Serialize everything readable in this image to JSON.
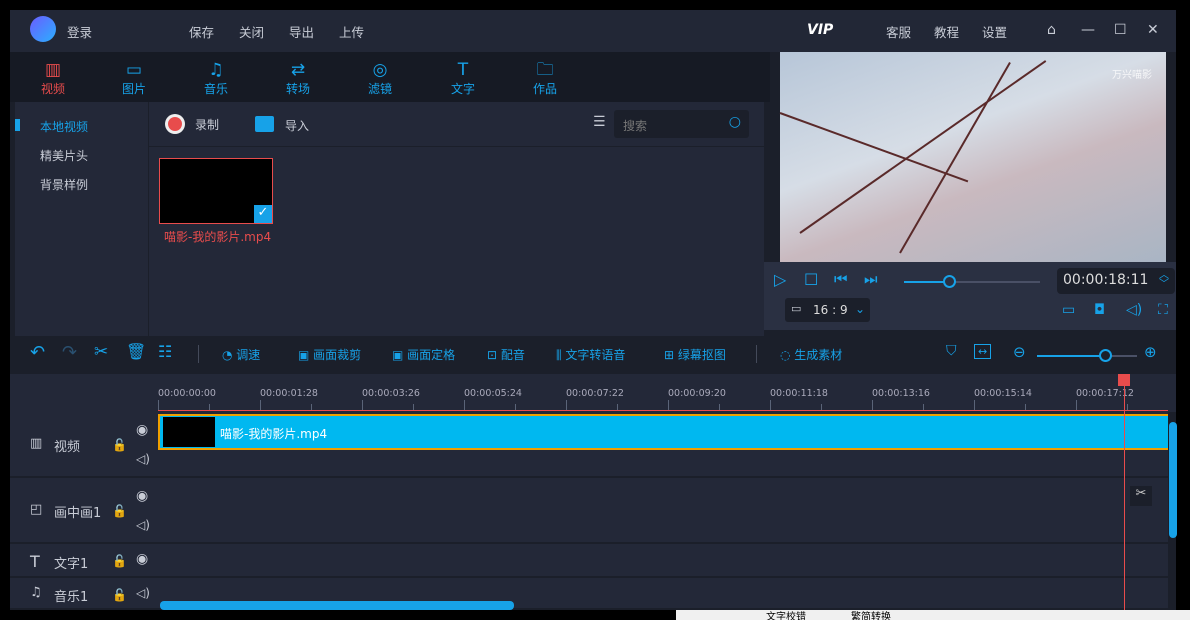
{
  "title_bar": {
    "login": "登录",
    "menu": [
      "保存",
      "关闭",
      "导出",
      "上传"
    ],
    "vip": "VIP",
    "right_menu": [
      "客服",
      "教程",
      "设置"
    ]
  },
  "categories": [
    {
      "label": "视频",
      "icon": "film-icon",
      "active": true
    },
    {
      "label": "图片",
      "icon": "image-icon"
    },
    {
      "label": "音乐",
      "icon": "music-icon"
    },
    {
      "label": "转场",
      "icon": "transition-icon"
    },
    {
      "label": "滤镜",
      "icon": "filter-icon"
    },
    {
      "label": "文字",
      "icon": "text-icon"
    },
    {
      "label": "作品",
      "icon": "folder-icon"
    }
  ],
  "sidebar": {
    "items": [
      "本地视频",
      "精美片头",
      "背景样例"
    ]
  },
  "media": {
    "record": "录制",
    "import": "导入",
    "search_placeholder": "搜索",
    "items": [
      {
        "name": "喵影-我的影片.mp4"
      }
    ]
  },
  "player": {
    "time": "00:00:18:11",
    "aspect": "16 : 9",
    "progress": 0.33,
    "watermark": "万兴喵影"
  },
  "toolbar": {
    "speed": "调速",
    "crop": "画面裁剪",
    "freeze": "画面定格",
    "dub": "配音",
    "tts": "文字转语音",
    "greenscreen": "绿幕抠图",
    "generate": "生成素材",
    "zoom_level": 0.68
  },
  "ruler": [
    "00:00:00:00",
    "00:00:01:28",
    "00:00:03:26",
    "00:00:05:24",
    "00:00:07:22",
    "00:00:09:20",
    "00:00:11:18",
    "00:00:13:16",
    "00:00:15:14",
    "00:00:17:12"
  ],
  "tracks": [
    {
      "name": "视频",
      "icon": "film-icon"
    },
    {
      "name": "画中画1",
      "icon": "pip-icon"
    },
    {
      "name": "文字1",
      "icon": "text-icon"
    },
    {
      "name": "音乐1",
      "icon": "music-icon"
    }
  ],
  "clip": {
    "name": "喵影-我的影片.mp4"
  },
  "bottom_strip": [
    "文字校错",
    "繁简转换"
  ],
  "colors": {
    "accent": "#17a2e8",
    "active": "#e84c4c",
    "clip": "#00b8f0"
  }
}
